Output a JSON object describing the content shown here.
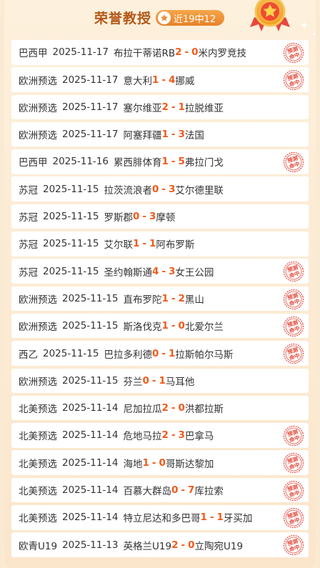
{
  "header": {
    "title": "荣誉教授",
    "record": "近19中12",
    "icons": {
      "badge": "star-icon",
      "medal": "medal-icon",
      "stamp": "stamp-icon"
    }
  },
  "colors": {
    "accent": "#f05a1a",
    "title": "#b3581a",
    "badge": "#ec8c32",
    "stamp": "#e24a3b"
  },
  "stamp_text": [
    "预测",
    "命中"
  ],
  "matches": [
    {
      "league": "巴西甲",
      "date": "2025-11-17",
      "home": "布拉干蒂诺RB",
      "home_score": "2",
      "away_score": "0",
      "away": "米内罗竞技",
      "hit": true
    },
    {
      "league": "欧洲预选",
      "date": "2025-11-17",
      "home": "意大利",
      "home_score": "1",
      "away_score": "4",
      "away": "挪威",
      "hit": true
    },
    {
      "league": "欧洲预选",
      "date": "2025-11-17",
      "home": "塞尔维亚",
      "home_score": "2",
      "away_score": "1",
      "away": "拉脱维亚",
      "hit": false
    },
    {
      "league": "欧洲预选",
      "date": "2025-11-17",
      "home": "阿塞拜疆",
      "home_score": "1",
      "away_score": "3",
      "away": "法国",
      "hit": false
    },
    {
      "league": "巴西甲",
      "date": "2025-11-16",
      "home": "累西腓体育",
      "home_score": "1",
      "away_score": "5",
      "away": "弗拉门戈",
      "hit": true
    },
    {
      "league": "苏冠",
      "date": "2025-11-15",
      "home": "拉茨流浪者",
      "home_score": "0",
      "away_score": "3",
      "away": "艾尔德里联",
      "hit": false
    },
    {
      "league": "苏冠",
      "date": "2025-11-15",
      "home": "罗斯郡",
      "home_score": "0",
      "away_score": "3",
      "away": "摩顿",
      "hit": false
    },
    {
      "league": "苏冠",
      "date": "2025-11-15",
      "home": "艾尔联",
      "home_score": "1",
      "away_score": "1",
      "away": "阿布罗斯",
      "hit": false
    },
    {
      "league": "苏冠",
      "date": "2025-11-15",
      "home": "圣约翰斯通",
      "home_score": "4",
      "away_score": "3",
      "away": "女王公园",
      "hit": true
    },
    {
      "league": "欧洲预选",
      "date": "2025-11-15",
      "home": "直布罗陀",
      "home_score": "1",
      "away_score": "2",
      "away": "黑山",
      "hit": true
    },
    {
      "league": "欧洲预选",
      "date": "2025-11-15",
      "home": "斯洛伐克",
      "home_score": "1",
      "away_score": "0",
      "away": "北爱尔兰",
      "hit": true
    },
    {
      "league": "西乙",
      "date": "2025-11-15",
      "home": "巴拉多利德",
      "home_score": "0",
      "away_score": "1",
      "away": "拉斯帕尔马斯",
      "hit": true
    },
    {
      "league": "欧洲预选",
      "date": "2025-11-15",
      "home": "芬兰",
      "home_score": "0",
      "away_score": "1",
      "away": "马耳他",
      "hit": false
    },
    {
      "league": "北美预选",
      "date": "2025-11-14",
      "home": "尼加拉瓜",
      "home_score": "2",
      "away_score": "0",
      "away": "洪都拉斯",
      "hit": false
    },
    {
      "league": "北美预选",
      "date": "2025-11-14",
      "home": "危地马拉",
      "home_score": "2",
      "away_score": "3",
      "away": "巴拿马",
      "hit": true
    },
    {
      "league": "北美预选",
      "date": "2025-11-14",
      "home": "海地",
      "home_score": "1",
      "away_score": "0",
      "away": "哥斯达黎加",
      "hit": true
    },
    {
      "league": "北美预选",
      "date": "2025-11-14",
      "home": "百慕大群岛",
      "home_score": "0",
      "away_score": "7",
      "away": "库拉索",
      "hit": true
    },
    {
      "league": "北美预选",
      "date": "2025-11-14",
      "home": "特立尼达和多巴哥",
      "home_score": "1",
      "away_score": "1",
      "away": "牙买加",
      "hit": true
    },
    {
      "league": "欧青U19",
      "date": "2025-11-13",
      "home": "英格兰U19",
      "home_score": "2",
      "away_score": "0",
      "away": "立陶宛U19",
      "hit": true
    }
  ]
}
